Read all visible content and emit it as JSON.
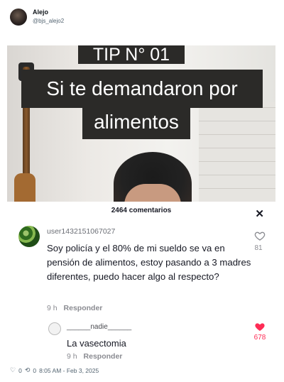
{
  "author": {
    "name": "Alejo",
    "handle": "@bjs_alejo2"
  },
  "video": {
    "caption_line1": "TIP N° 01",
    "caption_line2": "Si te demandaron por",
    "caption_line3": "alimentos"
  },
  "comments_panel": {
    "count_label": "2464 comentarios",
    "close_icon": "close-icon",
    "comment1": {
      "username": "user1432151067027",
      "text": "Soy policía y el 80% de mi sueldo se va en pensión de alimentos, estoy pasando a 3 madres diferentes, puedo hacer algo al respecto?",
      "time": "9 h",
      "reply_label": "Responder",
      "likes": "81"
    },
    "comment2": {
      "username": "______nadie______",
      "text": "La vasectomia",
      "time": "9 h",
      "reply_label": "Responder",
      "likes": "678",
      "like_color": "#fe2c55"
    }
  },
  "footer": {
    "likes": "0",
    "reposts": "0",
    "timestamp": "8:05 AM - Feb 3, 2025"
  }
}
